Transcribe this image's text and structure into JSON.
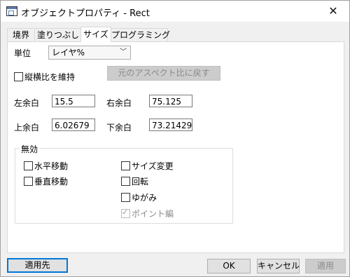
{
  "window": {
    "title": "オブジェクトプロパティ - Rect",
    "close_glyph": "✕"
  },
  "tabs": [
    {
      "label": "境界"
    },
    {
      "label": "塗りつぶし"
    },
    {
      "label": "サイズ"
    },
    {
      "label": "プログラミング"
    }
  ],
  "size_tab": {
    "unit_label": "単位",
    "unit_value": "レイヤ%",
    "keep_aspect_label": "縦横比を維持",
    "reset_aspect_button": "元のアスペクト比に戻す",
    "left_margin_label": "左余白",
    "left_margin_value": "15.5",
    "right_margin_label": "右余白",
    "right_margin_value": "75.125",
    "top_margin_label": "上余白",
    "top_margin_value": "6.02679",
    "bottom_margin_label": "下余白",
    "bottom_margin_value": "73.21429",
    "disable_group": {
      "title": "無効",
      "horizontal_move": "水平移動",
      "vertical_move": "垂直移動",
      "resize": "サイズ変更",
      "rotate": "回転",
      "skew": "ゆがみ",
      "point_edit": "ポイント編"
    }
  },
  "footer": {
    "apply_to": "適用先",
    "ok": "OK",
    "cancel": "キャンセル",
    "apply": "適用"
  }
}
